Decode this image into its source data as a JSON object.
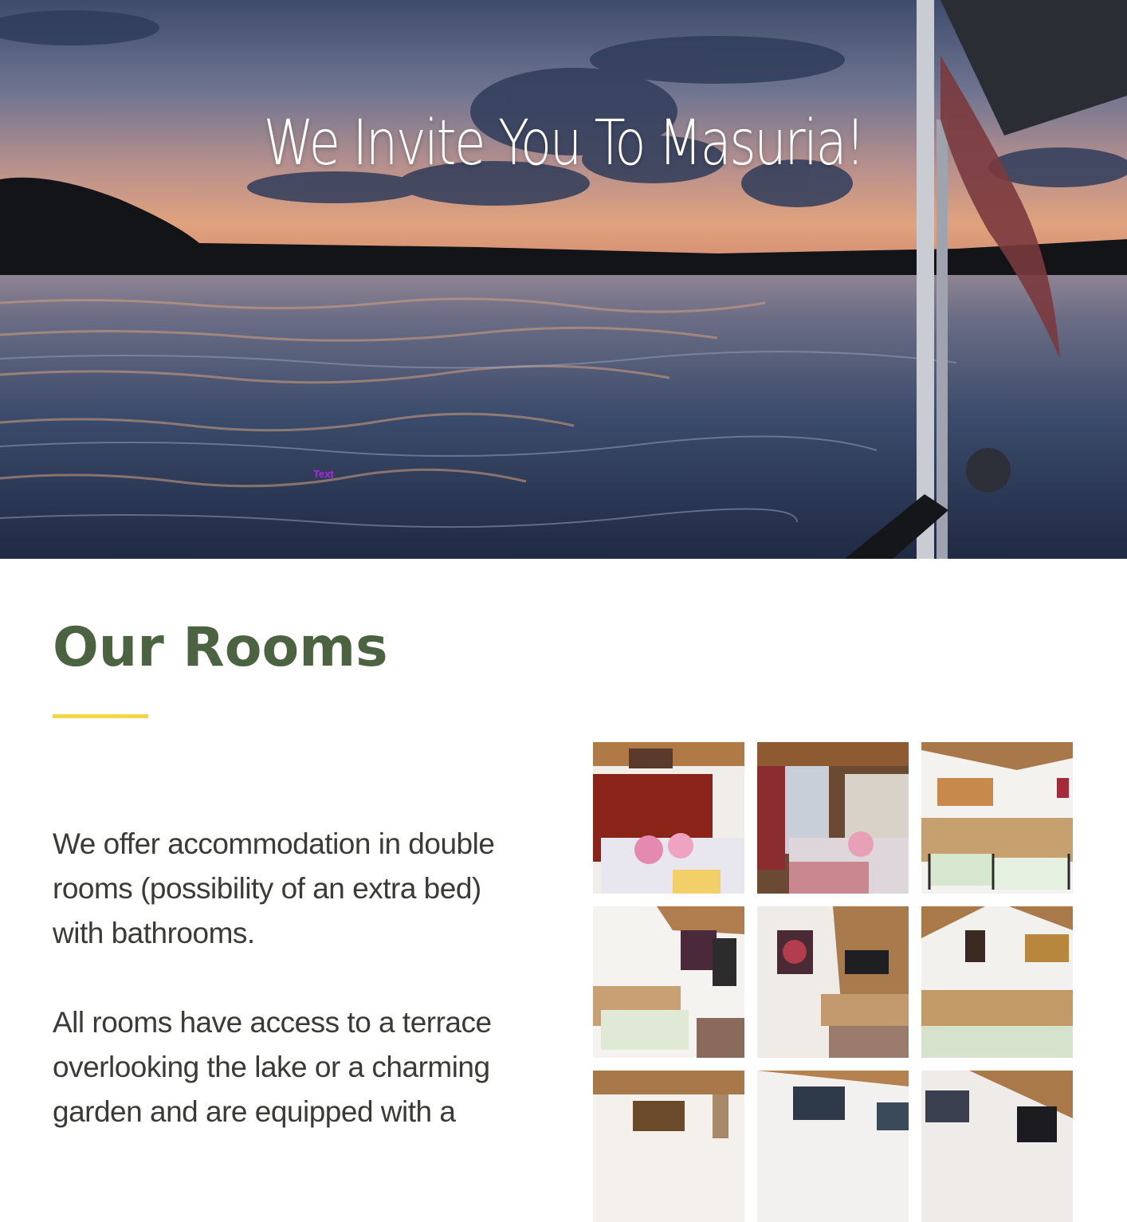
{
  "hero": {
    "title": "We Invite You To Masuria!",
    "marker_label": "Text"
  },
  "rooms": {
    "title": "Our Rooms",
    "paragraphs": [
      "We offer accommodation in double rooms (possibility of an extra bed) with bathrooms.",
      "All rooms have access to a terrace overlooking the lake or a charming garden and are equipped with a"
    ],
    "gallery_count": 9
  },
  "colors": {
    "heading": "#4b6340",
    "accent": "#f3d646",
    "body_text": "#3b3b35"
  }
}
